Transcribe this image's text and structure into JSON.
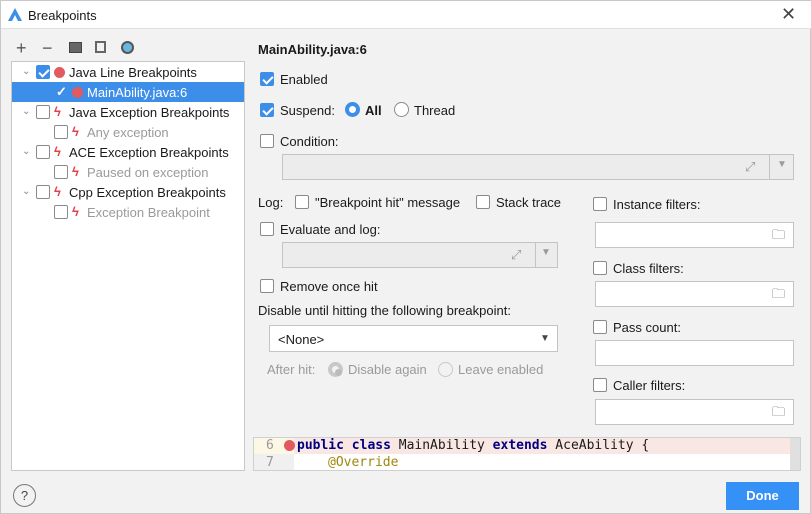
{
  "window": {
    "title": "Breakpoints"
  },
  "toolbar": [
    "add",
    "remove",
    "group-folder",
    "group-file",
    "group-class"
  ],
  "tree": [
    {
      "label": "Java Line Breakpoints",
      "checked": true,
      "icon": "red-dot-icon",
      "level": 0
    },
    {
      "label": "MainAbility.java:6",
      "checked": true,
      "icon": "red-dot-icon",
      "level": 1,
      "selected": true
    },
    {
      "label": "Java Exception Breakpoints",
      "checked": false,
      "icon": "lightning-icon",
      "level": 0
    },
    {
      "label": "Any exception",
      "checked": false,
      "icon": "lightning-icon",
      "level": 1
    },
    {
      "label": "ACE Exception Breakpoints",
      "checked": false,
      "icon": "lightning-icon",
      "level": 0
    },
    {
      "label": "Paused on exception",
      "checked": false,
      "icon": "lightning-icon",
      "level": 1
    },
    {
      "label": "Cpp Exception Breakpoints",
      "checked": false,
      "icon": "lightning-icon",
      "level": 0
    },
    {
      "label": "Exception Breakpoint",
      "checked": false,
      "icon": "lightning-icon",
      "level": 1
    }
  ],
  "detail": {
    "title": "MainAbility.java:6",
    "enabled": "Enabled",
    "suspend": "Suspend:",
    "all": "All",
    "thread": "Thread",
    "condition": "Condition:",
    "log": "Log:",
    "log_message": "\"Breakpoint hit\" message",
    "stack_trace": "Stack trace",
    "evaluate": "Evaluate and log:",
    "remove_once": "Remove once hit",
    "disable_until": "Disable until hitting the following breakpoint:",
    "none_option": "<None>",
    "after_hit": "After hit:",
    "disable_again": "Disable again",
    "leave_enabled": "Leave enabled",
    "instance_filters": "Instance filters:",
    "class_filters": "Class filters:",
    "pass_count": "Pass count:",
    "caller_filters": "Caller filters:"
  },
  "code": {
    "lines": [
      {
        "num": "6",
        "kw1": "public class",
        "name": " MainAbility ",
        "kw2": "extends",
        "rest": " AceAbility {"
      },
      {
        "num": "7",
        "annotation": "@Override"
      }
    ]
  },
  "buttons": {
    "done": "Done",
    "help": "?"
  },
  "colors": {
    "accent": "#3d8ee8",
    "breakpoint": "#e05a5f",
    "done": "#3591f5"
  }
}
